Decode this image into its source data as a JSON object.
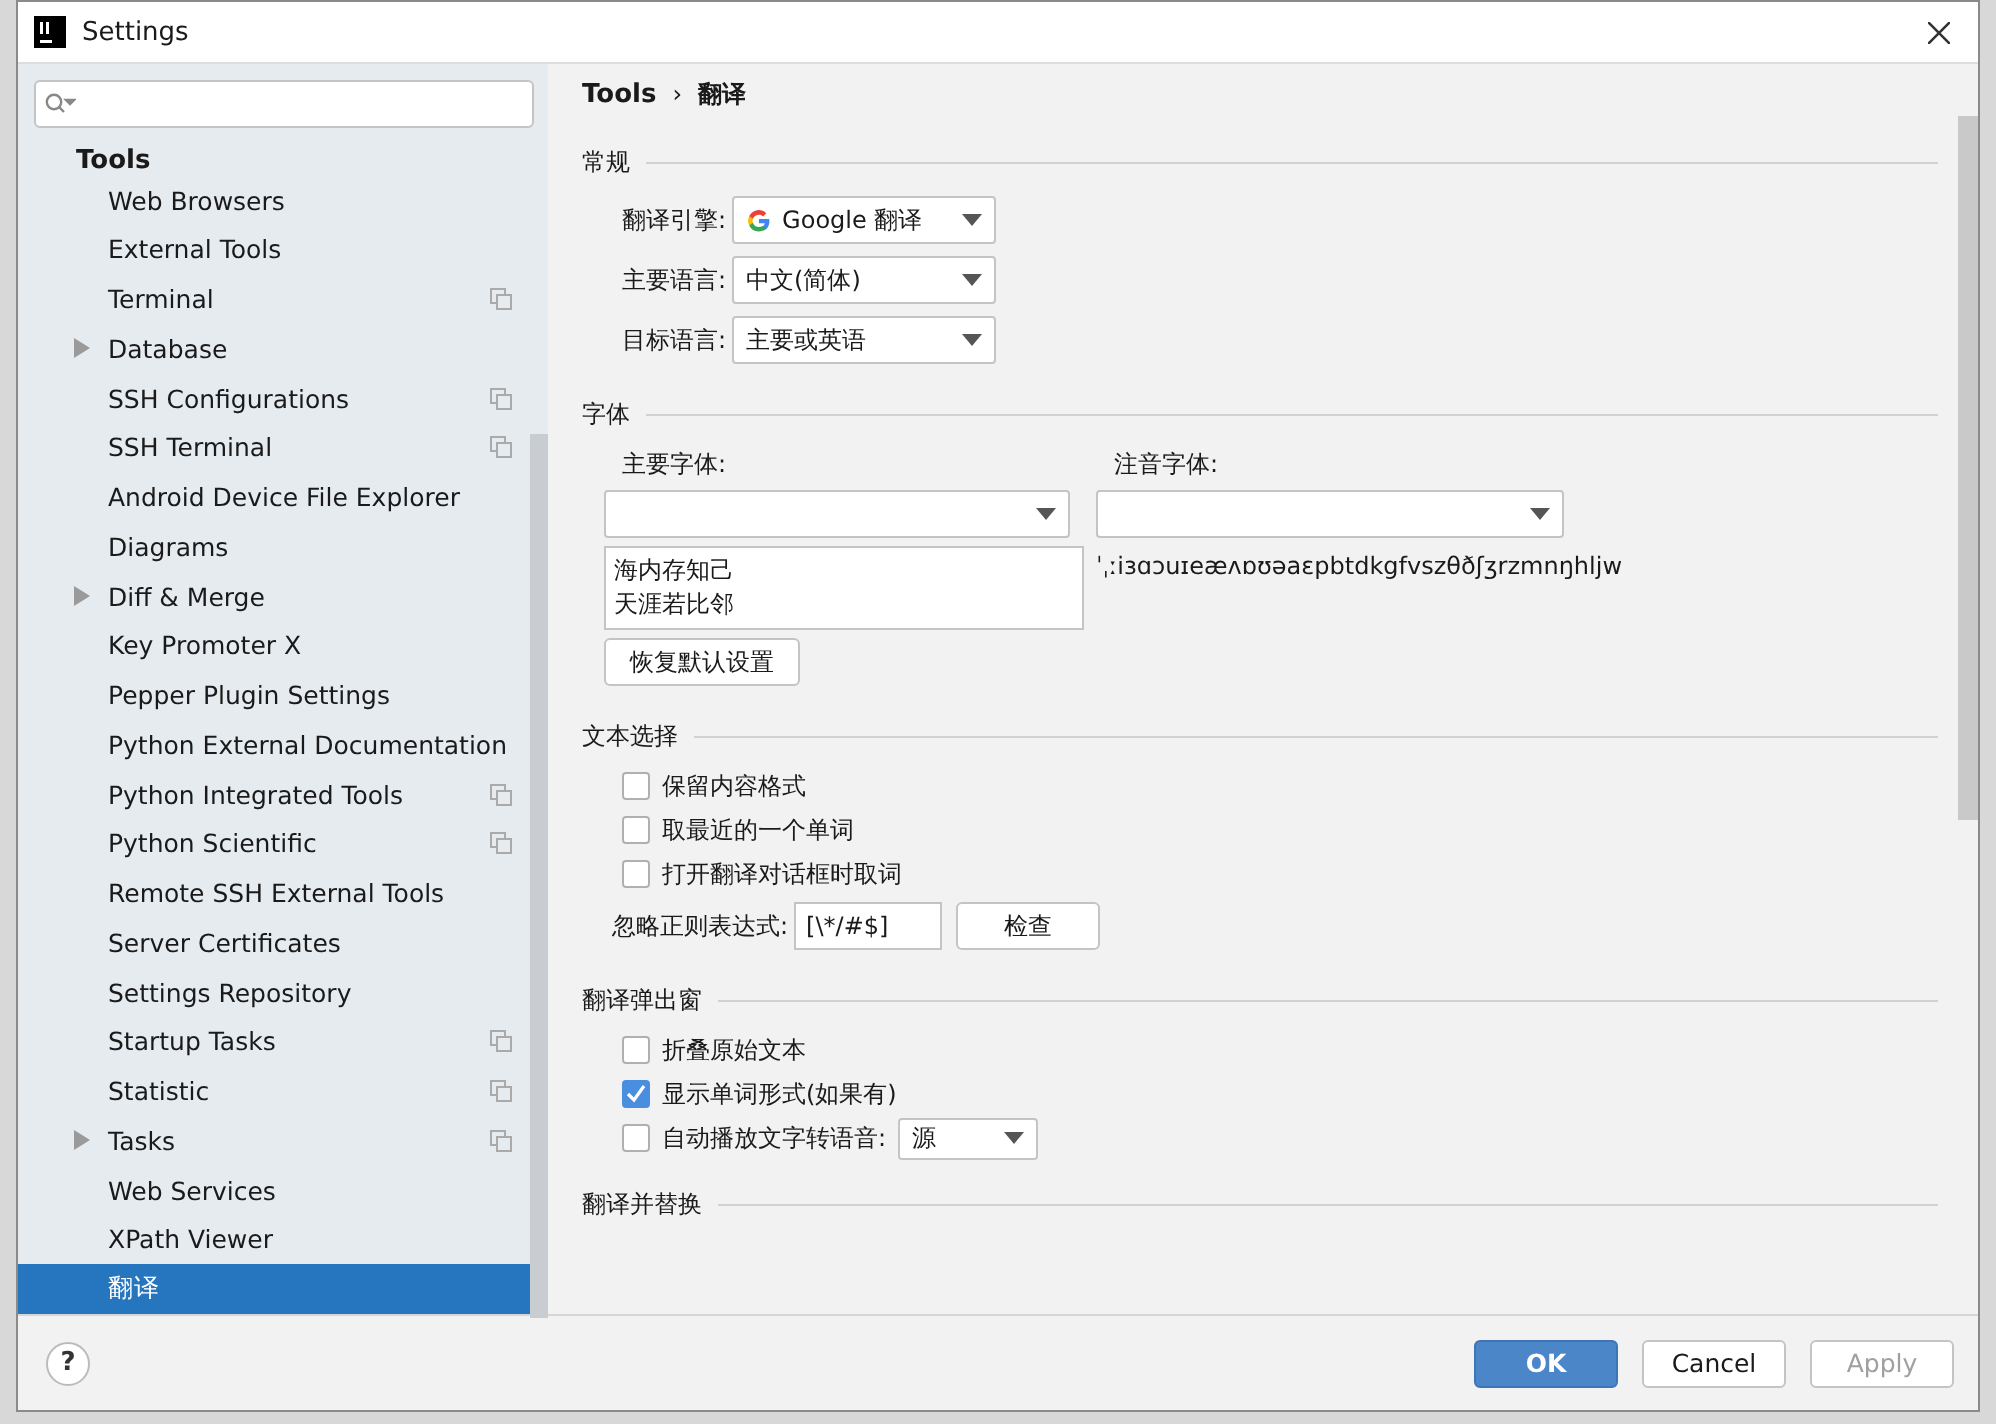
{
  "window": {
    "title": "Settings"
  },
  "sidebar": {
    "header": "Tools",
    "items": [
      {
        "label": "Web Browsers",
        "expandable": false,
        "project": false,
        "selected": false
      },
      {
        "label": "External Tools",
        "expandable": false,
        "project": false,
        "selected": false
      },
      {
        "label": "Terminal",
        "expandable": false,
        "project": true,
        "selected": false
      },
      {
        "label": "Database",
        "expandable": true,
        "project": false,
        "selected": false
      },
      {
        "label": "SSH Configurations",
        "expandable": false,
        "project": true,
        "selected": false
      },
      {
        "label": "SSH Terminal",
        "expandable": false,
        "project": true,
        "selected": false
      },
      {
        "label": "Android Device File Explorer",
        "expandable": false,
        "project": false,
        "selected": false
      },
      {
        "label": "Diagrams",
        "expandable": false,
        "project": false,
        "selected": false
      },
      {
        "label": "Diff & Merge",
        "expandable": true,
        "project": false,
        "selected": false
      },
      {
        "label": "Key Promoter X",
        "expandable": false,
        "project": false,
        "selected": false
      },
      {
        "label": "Pepper Plugin Settings",
        "expandable": false,
        "project": false,
        "selected": false
      },
      {
        "label": "Python External Documentation",
        "expandable": false,
        "project": false,
        "selected": false
      },
      {
        "label": "Python Integrated Tools",
        "expandable": false,
        "project": true,
        "selected": false
      },
      {
        "label": "Python Scientific",
        "expandable": false,
        "project": true,
        "selected": false
      },
      {
        "label": "Remote SSH External Tools",
        "expandable": false,
        "project": false,
        "selected": false
      },
      {
        "label": "Server Certificates",
        "expandable": false,
        "project": false,
        "selected": false
      },
      {
        "label": "Settings Repository",
        "expandable": false,
        "project": false,
        "selected": false
      },
      {
        "label": "Startup Tasks",
        "expandable": false,
        "project": true,
        "selected": false
      },
      {
        "label": "Statistic",
        "expandable": false,
        "project": true,
        "selected": false
      },
      {
        "label": "Tasks",
        "expandable": true,
        "project": true,
        "selected": false
      },
      {
        "label": "Web Services",
        "expandable": false,
        "project": false,
        "selected": false
      },
      {
        "label": "XPath Viewer",
        "expandable": false,
        "project": false,
        "selected": false
      },
      {
        "label": "翻译",
        "expandable": false,
        "project": false,
        "selected": true
      }
    ]
  },
  "breadcrumb": {
    "parent": "Tools",
    "separator": "›",
    "current": "翻译"
  },
  "sections": [
    {
      "title": "常规",
      "items": [
        {
          "kind": "select",
          "label": "翻译引擎:",
          "value": "Google 翻译",
          "logo": true
        },
        {
          "kind": "select",
          "label": "主要语言:",
          "value": "中文(简体)",
          "logo": false
        },
        {
          "kind": "select",
          "label": "目标语言:",
          "value": "主要或英语",
          "logo": false
        }
      ]
    },
    {
      "title": "字体",
      "items": [
        {
          "kind": "fonts",
          "primary_label": "主要字体:",
          "phonetic_label": "注音字体:",
          "preview_lines": [
            "海内存知己",
            "天涯若比邻"
          ],
          "phonetic_preview": "ˈˌːiɜɑɔuɪeæʌɒʊəaɛpbtdkgfvszθðʃʒrzmnŋhljw",
          "reset_button": "恢复默认设置"
        }
      ]
    },
    {
      "title": "文本选择",
      "items": [
        {
          "kind": "checkbox",
          "label": "保留内容格式",
          "checked": false
        },
        {
          "kind": "checkbox",
          "label": "取最近的一个单词",
          "checked": false
        },
        {
          "kind": "checkbox",
          "label": "打开翻译对话框时取词",
          "checked": false
        },
        {
          "kind": "regex",
          "label": "忽略正则表达式:",
          "value": "[\\*/#$]",
          "button": "检查"
        }
      ]
    },
    {
      "title": "翻译弹出窗",
      "items": [
        {
          "kind": "checkbox",
          "label": "折叠原始文本",
          "checked": false
        },
        {
          "kind": "checkbox",
          "label": "显示单词形式(如果有)",
          "checked": true
        },
        {
          "kind": "checkbox_select",
          "label": "自动播放文字转语音:",
          "checked": false,
          "value": "源"
        }
      ]
    },
    {
      "title": "翻译并替换"
    }
  ],
  "footer": {
    "help": "?",
    "buttons": [
      {
        "label": "OK",
        "primary": true,
        "disabled": false
      },
      {
        "label": "Cancel",
        "primary": false,
        "disabled": false
      },
      {
        "label": "Apply",
        "primary": false,
        "disabled": true
      }
    ]
  }
}
